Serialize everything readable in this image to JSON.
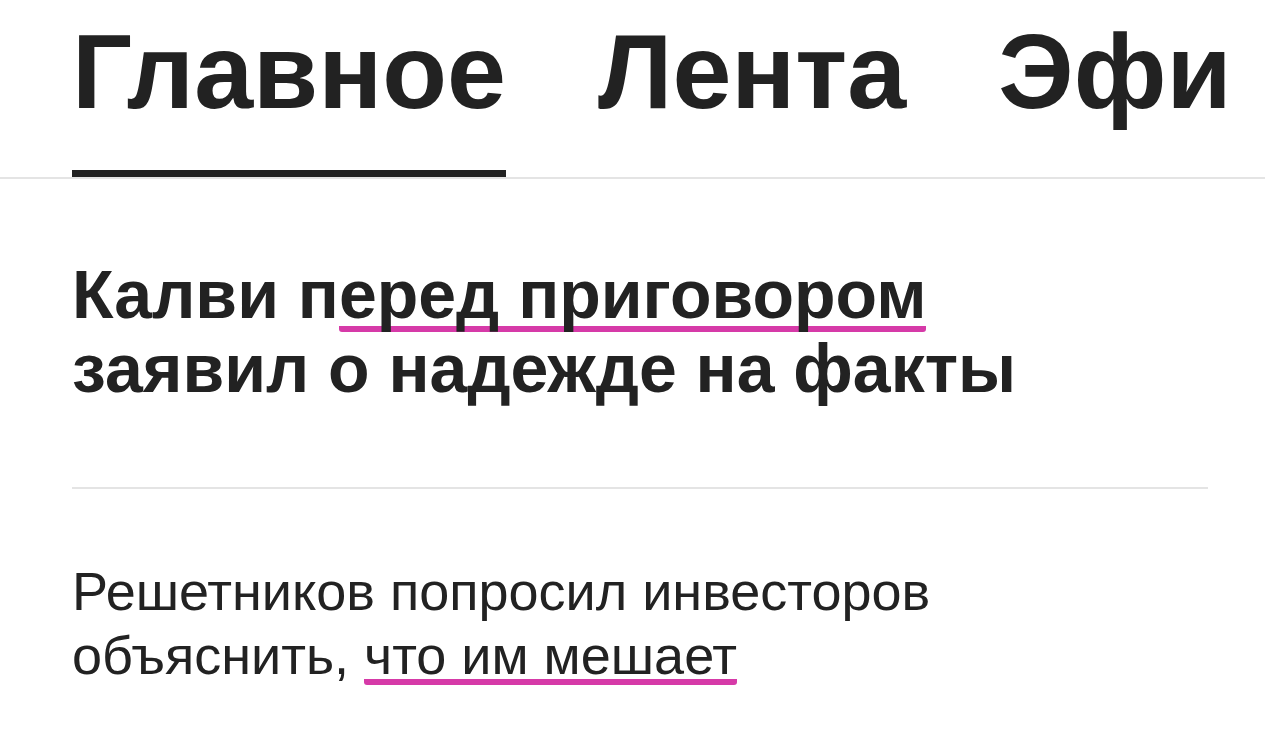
{
  "tabs": [
    {
      "label": "Главное",
      "selected": true
    },
    {
      "label": "Лента",
      "selected": false
    },
    {
      "label": "Эфи",
      "selected": false
    }
  ],
  "news": [
    {
      "kind": "headline",
      "segments": [
        {
          "text": "Калви п",
          "underlined": false
        },
        {
          "text": "еред приговором",
          "underlined": true
        },
        {
          "text": " заявил о надежде на факты",
          "underlined": false
        }
      ]
    },
    {
      "kind": "item",
      "segments": [
        {
          "text": "Решетников попросил инвесторов объяснить, ",
          "underlined": false
        },
        {
          "text": "что им мешает",
          "underlined": true
        }
      ]
    }
  ]
}
